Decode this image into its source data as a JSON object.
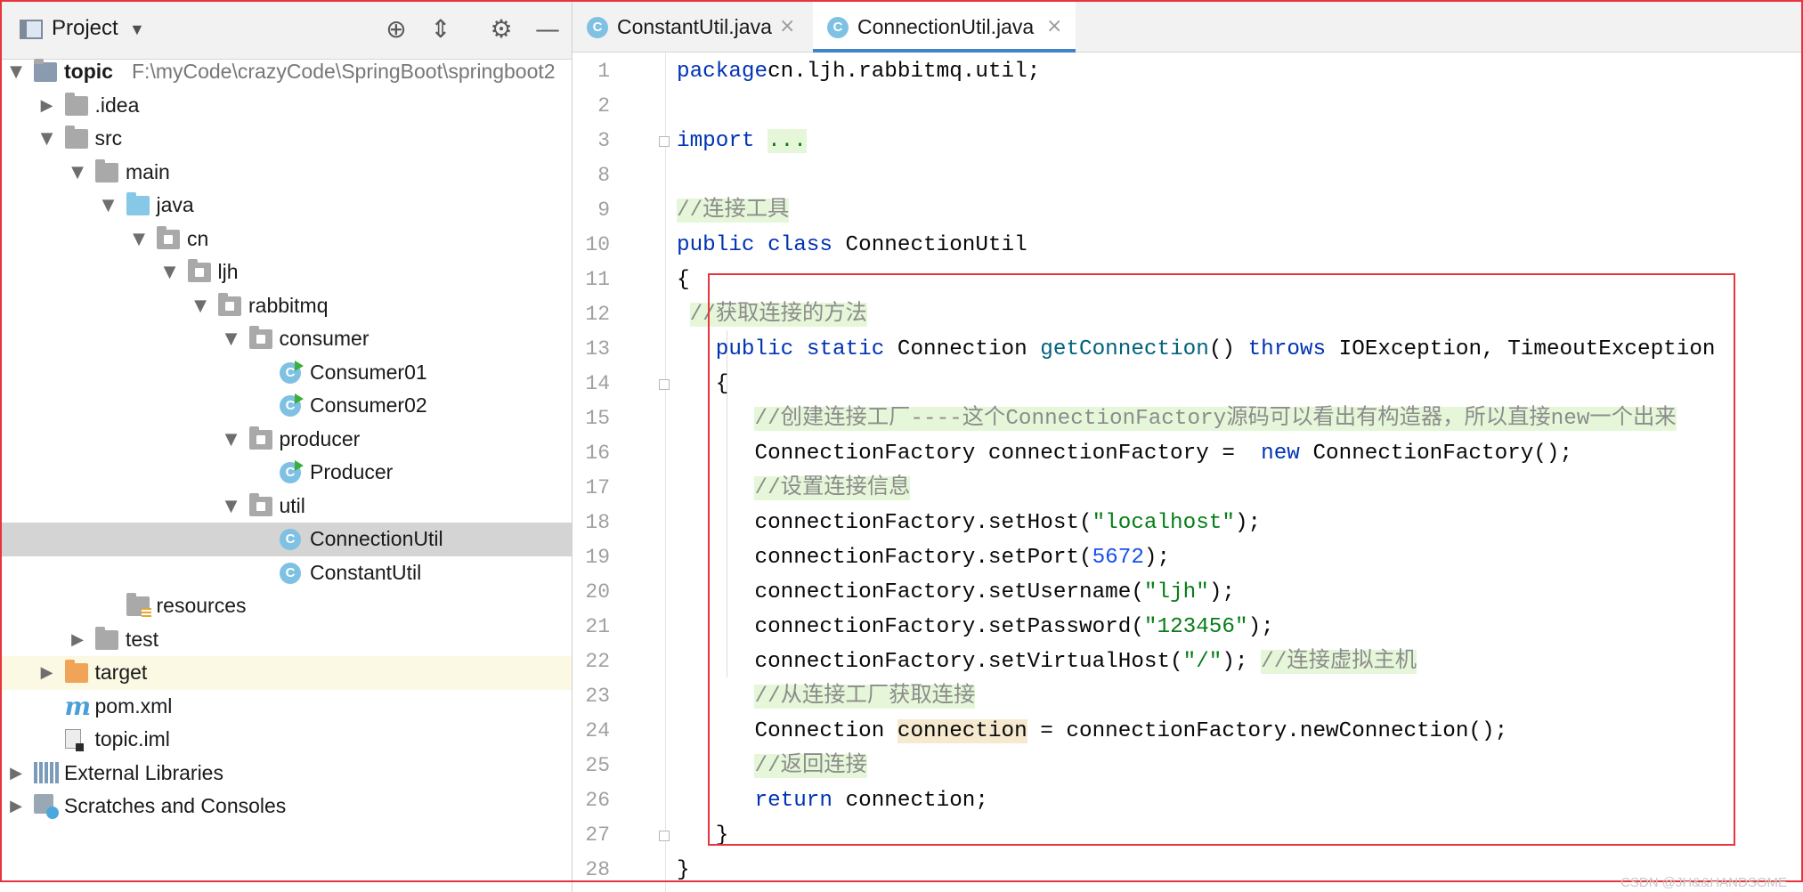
{
  "project": {
    "title": "Project",
    "tools": {
      "locate": "⊕",
      "collapse": "⇕",
      "settings": "⚙",
      "hide": "—"
    },
    "tree": [
      {
        "label": "topic",
        "path": "F:\\myCode\\crazyCode\\SpringBoot\\springboot2",
        "level": 0,
        "arrow": "down",
        "icon": "module",
        "bold": true
      },
      {
        "label": ".idea",
        "level": 1,
        "arrow": "right",
        "icon": "folder"
      },
      {
        "label": "src",
        "level": 1,
        "arrow": "down",
        "icon": "folder"
      },
      {
        "label": "main",
        "level": 2,
        "arrow": "down",
        "icon": "folder"
      },
      {
        "label": "java",
        "level": 3,
        "arrow": "down",
        "icon": "folder-blue"
      },
      {
        "label": "cn",
        "level": 4,
        "arrow": "down",
        "icon": "package"
      },
      {
        "label": "ljh",
        "level": 5,
        "arrow": "down",
        "icon": "package"
      },
      {
        "label": "rabbitmq",
        "level": 6,
        "arrow": "down",
        "icon": "package"
      },
      {
        "label": "consumer",
        "level": 7,
        "arrow": "down",
        "icon": "package"
      },
      {
        "label": "Consumer01",
        "level": 8,
        "icon": "class-run"
      },
      {
        "label": "Consumer02",
        "level": 8,
        "icon": "class-run"
      },
      {
        "label": "producer",
        "level": 7,
        "arrow": "down",
        "icon": "package"
      },
      {
        "label": "Producer",
        "level": 8,
        "icon": "class-run"
      },
      {
        "label": "util",
        "level": 7,
        "arrow": "down",
        "icon": "package"
      },
      {
        "label": "ConnectionUtil",
        "level": 8,
        "icon": "class",
        "selected": true
      },
      {
        "label": "ConstantUtil",
        "level": 8,
        "icon": "class"
      },
      {
        "label": "resources",
        "level": 3,
        "icon": "resources"
      },
      {
        "label": "test",
        "level": 2,
        "arrow": "right",
        "icon": "folder"
      },
      {
        "label": "target",
        "level": 1,
        "arrow": "right",
        "icon": "folder-orange",
        "excluded": true
      },
      {
        "label": "pom.xml",
        "level": 1,
        "icon": "maven"
      },
      {
        "label": "topic.iml",
        "level": 1,
        "icon": "iml"
      },
      {
        "label": "External Libraries",
        "level": 0,
        "arrow": "right",
        "icon": "libraries"
      },
      {
        "label": "Scratches and Consoles",
        "level": 0,
        "arrow": "right",
        "icon": "scratches"
      }
    ]
  },
  "tabs": [
    {
      "label": "ConstantUtil.java",
      "active": false,
      "icon": "class-icon"
    },
    {
      "label": "ConnectionUtil.java",
      "active": true,
      "icon": "class-icon"
    }
  ],
  "editor": {
    "lines": [
      {
        "n": "1",
        "segs": [
          [
            "kw",
            "package"
          ],
          [
            "",
            "cn.ljh.rabbitmq.util;"
          ]
        ]
      },
      {
        "n": "2",
        "segs": []
      },
      {
        "n": "3",
        "fold": true,
        "segs": [
          [
            "kw",
            "import"
          ],
          [
            "",
            " "
          ],
          [
            "fold",
            "..."
          ]
        ]
      },
      {
        "n": "8",
        "segs": []
      },
      {
        "n": "9",
        "segs": [
          [
            "cm",
            "//连接工具"
          ]
        ]
      },
      {
        "n": "10",
        "segs": [
          [
            "kw",
            "public class "
          ],
          [
            "",
            "ConnectionUtil"
          ]
        ]
      },
      {
        "n": "11",
        "segs": [
          [
            "",
            "{"
          ]
        ]
      },
      {
        "n": "12",
        "segs": [
          [
            "",
            " "
          ],
          [
            "cm",
            "//获取连接的方法"
          ]
        ]
      },
      {
        "n": "13",
        "segs": [
          [
            "",
            "   "
          ],
          [
            "kw",
            "public static "
          ],
          [
            "",
            "Connection "
          ],
          [
            "fn",
            "getConnection"
          ],
          [
            "",
            "() "
          ],
          [
            "kw",
            "throws "
          ],
          [
            "",
            "IOException, TimeoutException"
          ]
        ]
      },
      {
        "n": "14",
        "fold": true,
        "segs": [
          [
            "",
            "   {"
          ]
        ]
      },
      {
        "n": "15",
        "segs": [
          [
            "",
            "      "
          ],
          [
            "cm",
            "//创建连接工厂----这个ConnectionFactory源码可以看出有构造器，所以直接new一个出来"
          ]
        ]
      },
      {
        "n": "16",
        "segs": [
          [
            "",
            "      ConnectionFactory connectionFactory =  "
          ],
          [
            "kw",
            "new "
          ],
          [
            "",
            "ConnectionFactory();"
          ]
        ]
      },
      {
        "n": "17",
        "segs": [
          [
            "",
            "      "
          ],
          [
            "cm",
            "//设置连接信息"
          ]
        ]
      },
      {
        "n": "18",
        "segs": [
          [
            "",
            "      connectionFactory.setHost("
          ],
          [
            "str",
            "\"localhost\""
          ],
          [
            "",
            ");"
          ]
        ]
      },
      {
        "n": "19",
        "segs": [
          [
            "",
            "      connectionFactory.setPort("
          ],
          [
            "num",
            "5672"
          ],
          [
            "",
            ");"
          ]
        ]
      },
      {
        "n": "20",
        "segs": [
          [
            "",
            "      connectionFactory.setUsername("
          ],
          [
            "str",
            "\"ljh\""
          ],
          [
            "",
            ");"
          ]
        ]
      },
      {
        "n": "21",
        "segs": [
          [
            "",
            "      connectionFactory.setPassword("
          ],
          [
            "str",
            "\"123456\""
          ],
          [
            "",
            ");"
          ]
        ]
      },
      {
        "n": "22",
        "segs": [
          [
            "",
            "      connectionFactory.setVirtualHost("
          ],
          [
            "str",
            "\"/\""
          ],
          [
            "",
            "); "
          ],
          [
            "cm",
            "//连接虚拟主机"
          ]
        ]
      },
      {
        "n": "23",
        "segs": [
          [
            "",
            "      "
          ],
          [
            "cm",
            "//从连接工厂获取连接"
          ]
        ]
      },
      {
        "n": "24",
        "segs": [
          [
            "",
            "      Connection "
          ],
          [
            "hl",
            "connection"
          ],
          [
            "",
            " = connectionFactory.newConnection();"
          ]
        ]
      },
      {
        "n": "25",
        "segs": [
          [
            "",
            "      "
          ],
          [
            "cm",
            "//返回连接"
          ]
        ]
      },
      {
        "n": "26",
        "segs": [
          [
            "",
            "      "
          ],
          [
            "kw",
            "return "
          ],
          [
            "",
            "connection;"
          ]
        ]
      },
      {
        "n": "27",
        "fold": true,
        "segs": [
          [
            "",
            "   }"
          ]
        ]
      },
      {
        "n": "28",
        "segs": [
          [
            "",
            "}"
          ]
        ]
      }
    ]
  },
  "watermark": "CSDN @JH&&HANDSOME",
  "colors": {
    "annotation_box": "#e8343c",
    "accent": "#4083c9"
  }
}
